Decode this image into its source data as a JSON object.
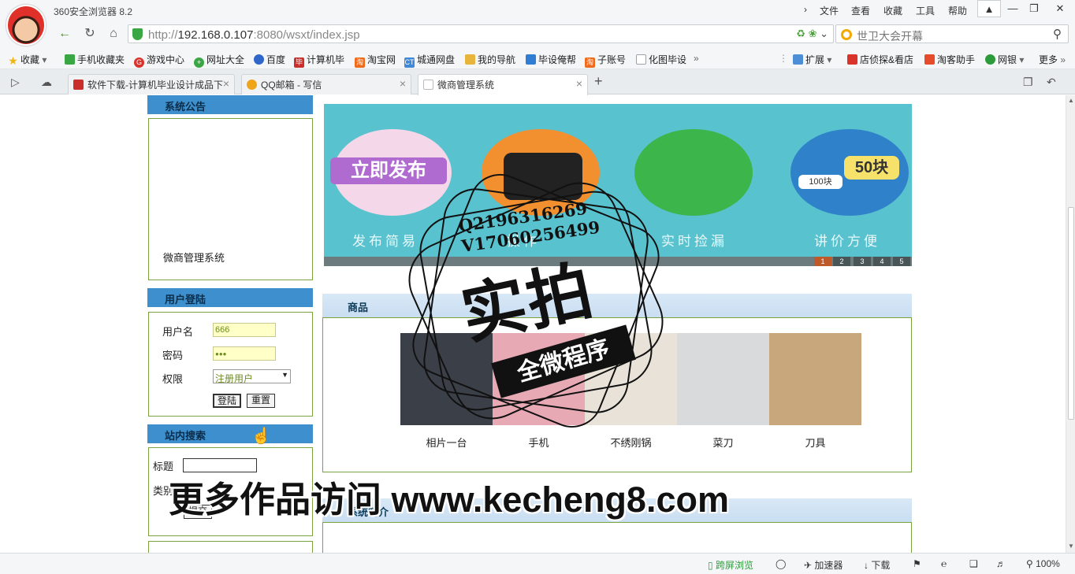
{
  "browser": {
    "app_title": "360安全浏览器 8.2",
    "menu": [
      "文件",
      "查看",
      "收藏",
      "工具",
      "帮助"
    ],
    "window_buttons": [
      "▲",
      "—",
      "❐",
      "✕"
    ]
  },
  "navbar": {
    "url_scheme": "http://",
    "url_host": "192.168.0.107",
    "url_rest": ":8080/wsxt/index.jsp",
    "search_placeholder": "世卫大会开幕"
  },
  "bookmarks": [
    {
      "label": "收藏",
      "icon": "star-icon",
      "color": "#f1b416"
    },
    {
      "label": "手机收藏夹",
      "icon": "phone-icon",
      "color": "#3aa745"
    },
    {
      "label": "游戏中心",
      "icon": "game-icon",
      "color": "#d9332b"
    },
    {
      "label": "网址大全",
      "icon": "globe-icon",
      "color": "#3aa745"
    },
    {
      "label": "百度",
      "icon": "paw-icon",
      "color": "#2f66c9"
    },
    {
      "label": "计算机毕",
      "icon": "bi-icon",
      "color": "#c9302c"
    },
    {
      "label": "淘宝网",
      "icon": "taobao-icon",
      "color": "#f06a1b"
    },
    {
      "label": "城通网盘",
      "icon": "ct-icon",
      "color": "#3f89d6"
    },
    {
      "label": "我的导航",
      "icon": "folder-icon",
      "color": "#e7b43c"
    },
    {
      "label": "毕设俺帮",
      "icon": "bishe-icon",
      "color": "#2f7ed3"
    },
    {
      "label": "子账号",
      "icon": "taobao-icon",
      "color": "#f06a1b"
    },
    {
      "label": "化图毕设",
      "icon": "page-icon",
      "color": "#9aa3ab"
    }
  ],
  "bookmarks_right": [
    {
      "label": "扩展",
      "icon": "grid-icon",
      "color": "#4d8fd6"
    },
    {
      "label": "店侦探&看店",
      "icon": "shop-icon",
      "color": "#d9332b"
    },
    {
      "label": "淘客助手",
      "icon": "tool-icon",
      "color": "#e64b2a"
    },
    {
      "label": "网银",
      "icon": "bank-icon",
      "color": "#2e9b3b"
    },
    {
      "label": "更多",
      "icon": "",
      "color": "#222"
    }
  ],
  "tabs": [
    {
      "label": "软件下载-计算机毕业设计成品下",
      "color": "#c9302c",
      "active": false
    },
    {
      "label": "QQ邮箱 - 写信",
      "color": "#f0a41a",
      "active": false
    },
    {
      "label": "微商管理系统",
      "color": "#bbbbbb",
      "active": true
    }
  ],
  "sidebar": {
    "notice_title": "系统公告",
    "notice_text": "微商管理系统",
    "login_title": "用户登陆",
    "username_label": "用户名",
    "username_value": "666",
    "password_label": "密码",
    "password_value": "●●●",
    "role_label": "权限",
    "role_value": "注册用户",
    "login_button": "登陆",
    "reset_button": "重置",
    "search_title": "站内搜索",
    "search_title_label": "标题",
    "search_category_label": "类别",
    "submit_button": "提交"
  },
  "banner": {
    "captions": [
      "发布简易",
      "操作",
      "实时捡漏",
      "讲价方便"
    ],
    "slide1_text": "立即发布",
    "slide4_text": "50块",
    "slide4_small": "100块",
    "pages": [
      "1",
      "2",
      "3",
      "4",
      "5"
    ],
    "active_page": 1
  },
  "products_section": {
    "title": "商品",
    "items": [
      {
        "name": "相片一台",
        "color": "#3b3f48"
      },
      {
        "name": "手机",
        "color": "#e7a9b4"
      },
      {
        "name": "不绣刚锅",
        "color": "#e8e2d8"
      },
      {
        "name": "菜刀",
        "color": "#d9dadc"
      },
      {
        "name": "刀具",
        "color": "#c9a77c"
      }
    ]
  },
  "about_section": {
    "title": "系统简介"
  },
  "overlay": {
    "stamp_lines": [
      "Q2196316269",
      "V17060256499"
    ],
    "stamp_big": "实拍",
    "stamp_ribbon": "全微程序",
    "watermark": "更多作品访问 www.kecheng8.com"
  },
  "statusbar": {
    "items": [
      "跨屏浏览",
      "加速器",
      "下载"
    ],
    "zoom": "100%"
  }
}
